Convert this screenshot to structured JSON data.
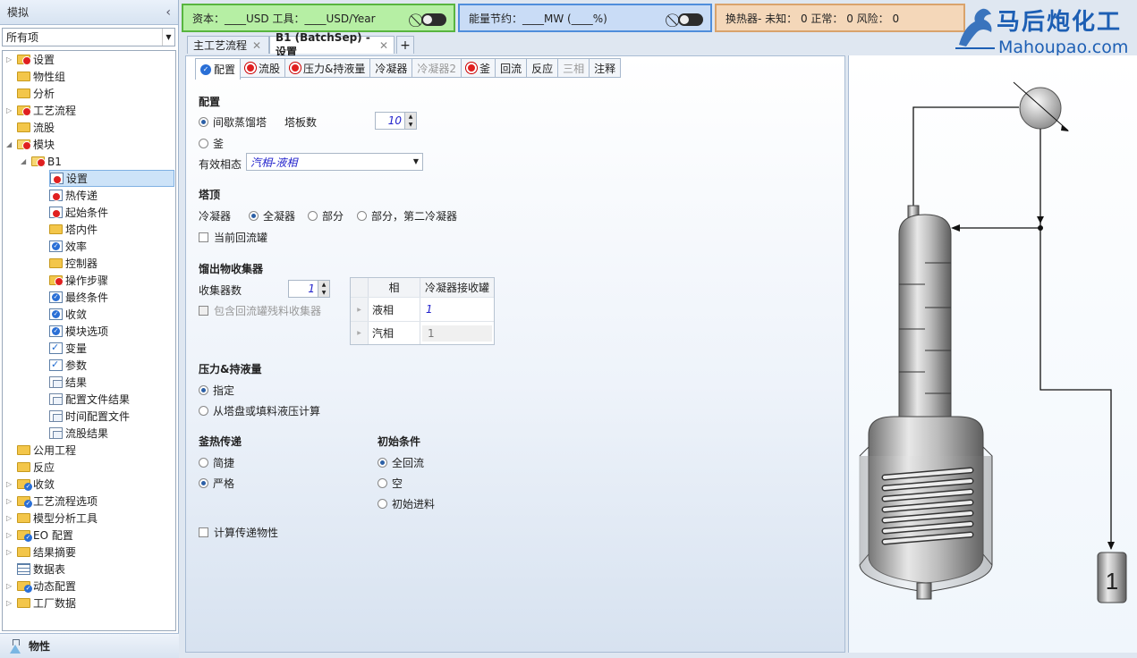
{
  "nav": {
    "title": "模拟",
    "filter": "所有项",
    "items": [
      {
        "label": "设置"
      },
      {
        "label": "物性组"
      },
      {
        "label": "分析"
      },
      {
        "label": "工艺流程"
      },
      {
        "label": "流股"
      },
      {
        "label": "模块"
      },
      {
        "label": "B1"
      },
      {
        "label": "设置"
      },
      {
        "label": "热传递"
      },
      {
        "label": "起始条件"
      },
      {
        "label": "塔内件"
      },
      {
        "label": "效率"
      },
      {
        "label": "控制器"
      },
      {
        "label": "操作步骤"
      },
      {
        "label": "最终条件"
      },
      {
        "label": "收敛"
      },
      {
        "label": "模块选项"
      },
      {
        "label": "变量"
      },
      {
        "label": "参数"
      },
      {
        "label": "结果"
      },
      {
        "label": "配置文件结果"
      },
      {
        "label": "时间配置文件"
      },
      {
        "label": "流股结果"
      },
      {
        "label": "公用工程"
      },
      {
        "label": "反应"
      },
      {
        "label": "收敛"
      },
      {
        "label": "工艺流程选项"
      },
      {
        "label": "模型分析工具"
      },
      {
        "label": "EO 配置"
      },
      {
        "label": "结果摘要"
      },
      {
        "label": "数据表"
      },
      {
        "label": "动态配置"
      },
      {
        "label": "工厂数据"
      }
    ],
    "bottom_label": "物性"
  },
  "status": {
    "capital": "资本：____USD   工具：____USD/Year",
    "energy": "能量节约：____MW    (____%)",
    "hx": "换热器- 未知：  0    正常：  0    风险：  0"
  },
  "logo": {
    "cn": "马后炮化工",
    "en": "Mahoupao.com"
  },
  "doc_tabs": [
    {
      "label": "主工艺流程"
    },
    {
      "label": "B1 (BatchSep) - 设置"
    }
  ],
  "sub_tabs": [
    {
      "label": "配置"
    },
    {
      "label": "流股"
    },
    {
      "label": "压力&持液量"
    },
    {
      "label": "冷凝器"
    },
    {
      "label": "冷凝器2"
    },
    {
      "label": "釜"
    },
    {
      "label": "回流"
    },
    {
      "label": "反应"
    },
    {
      "label": "三相"
    },
    {
      "label": "注释"
    }
  ],
  "config": {
    "title": "配置",
    "opt_batch": "间歇蒸馏塔",
    "stages_label": "塔板数",
    "stages_value": "10",
    "opt_pot": "釜",
    "phase_label": "有效相态",
    "phase_value": "汽相-液相"
  },
  "top": {
    "title": "塔顶",
    "condenser_label": "冷凝器",
    "opt_total": "全凝器",
    "opt_partial": "部分",
    "opt_partial2": "部分，第二冷凝器",
    "reflux_drum": "当前回流罐"
  },
  "receiver": {
    "title": "馏出物收集器",
    "count_label": "收集器数",
    "count_value": "1",
    "include_label": "包含回流罐残料收集器",
    "grid_headers": [
      "相",
      "冷凝器接收罐"
    ],
    "rows": [
      {
        "phase": "液相",
        "value": "1"
      },
      {
        "phase": "汽相",
        "value": "1"
      }
    ]
  },
  "pressure": {
    "title": "压力&持液量",
    "opt_spec": "指定",
    "opt_calc": "从塔盘或填料液压计算"
  },
  "pot_heat": {
    "title": "釜热传递",
    "opt_simple": "简捷",
    "opt_rigorous": "严格"
  },
  "init": {
    "title": "初始条件",
    "opt_total_reflux": "全回流",
    "opt_empty": "空",
    "opt_feed": "初始进料"
  },
  "calc_props": "计算传递物性",
  "diagram": {
    "receiver_label": "1"
  }
}
